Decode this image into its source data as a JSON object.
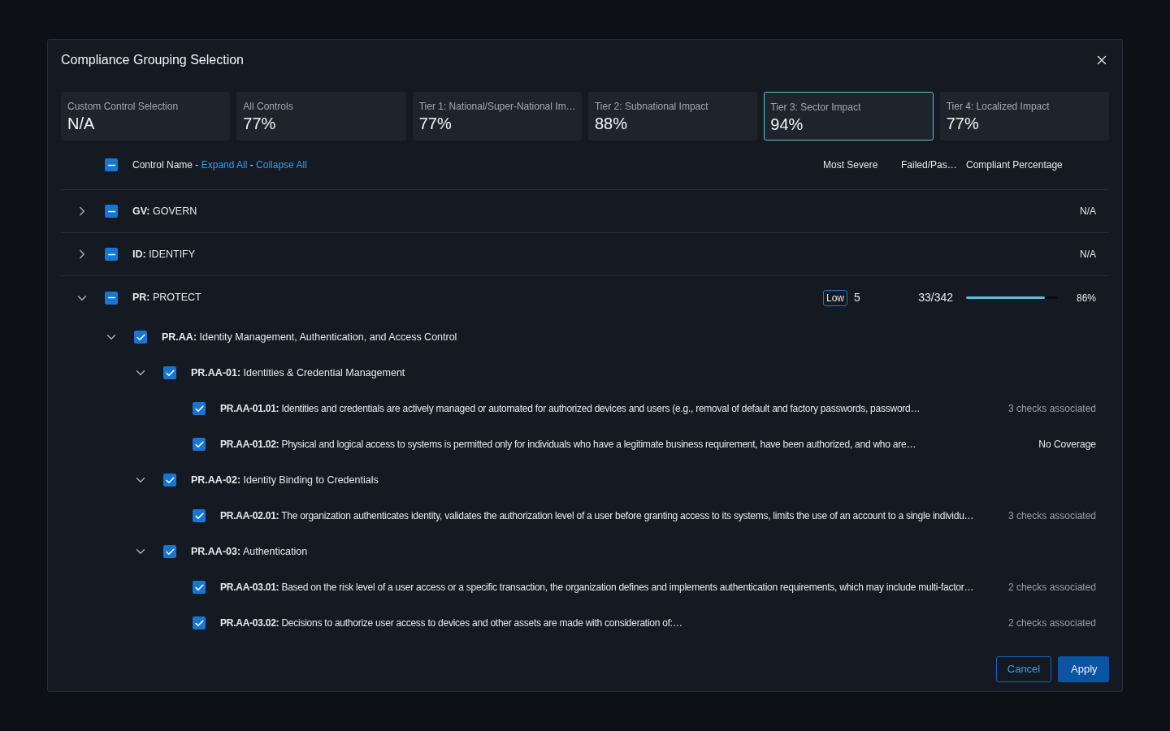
{
  "dialog": {
    "title": "Compliance Grouping Selection"
  },
  "cards": [
    {
      "label": "Custom Control Selection",
      "value": "N/A",
      "selected": false
    },
    {
      "label": "All Controls",
      "value": "77%",
      "selected": false
    },
    {
      "label": "Tier 1: National/Super-National Im…",
      "value": "77%",
      "selected": false
    },
    {
      "label": "Tier 2: Subnational Impact",
      "value": "88%",
      "selected": false
    },
    {
      "label": "Tier 3: Sector Impact",
      "value": "94%",
      "selected": true
    },
    {
      "label": "Tier 4: Localized Impact",
      "value": "77%",
      "selected": false
    }
  ],
  "header": {
    "checked": true,
    "partial": true,
    "parts": [
      {
        "kind": "text",
        "text": "Control Name - "
      },
      {
        "kind": "link",
        "text": "Expand All"
      },
      {
        "kind": "text",
        "text": " - "
      },
      {
        "kind": "link",
        "text": "Collapse All"
      }
    ],
    "columns": [
      "Most Severe",
      "Failed/Pas…",
      "Compliant Percentage"
    ]
  },
  "rows": [
    {
      "label": "**GV:** GOVERN",
      "checked": true,
      "partial": true,
      "expanded": false,
      "compliance": "N/A"
    },
    {
      "label": "**ID:** IDENTIFY",
      "checked": true,
      "partial": true,
      "expanded": false,
      "compliance": "N/A"
    },
    {
      "label": "**PR:** PROTECT",
      "checked": true,
      "partial": true,
      "expanded": true,
      "severity": "Low",
      "severe_count": "5",
      "failed_passed": "33/342",
      "level": 0.86,
      "compliance": "86%",
      "children": [
        {
          "label": "**PR.AA:** Identity Management, Authentication, and Access Control",
          "checked": true,
          "expanded": true,
          "children": [
            {
              "label": "**PR.AA-01:** Identities & Credential Management",
              "checked": true,
              "expanded": true,
              "children": [
                {
                  "label": "**PR.AA-01.01:** Identities and credentials are actively managed or automated for authorized devices and users (e.g., removal of default and factory passwords, password…",
                  "checked": true,
                  "coverage": "3 checks associated",
                  "covered": true
                },
                {
                  "label": "**PR.AA-01.02:** Physical and logical access to systems is permitted only for individuals who have a legitimate business requirement, have been authorized, and who are…",
                  "checked": true,
                  "coverage": "No Coverage",
                  "covered": false
                }
              ]
            },
            {
              "label": "**PR.AA-02:** Identity Binding to Credentials",
              "checked": true,
              "expanded": true,
              "children": [
                {
                  "label": "**PR.AA-02.01:** The organization authenticates identity, validates the authorization level of a user before granting access to its systems, limits the use of an account to a single individu…",
                  "checked": true,
                  "coverage": "3 checks associated",
                  "covered": true
                }
              ]
            },
            {
              "label": "**PR.AA-03:** Authentication",
              "checked": true,
              "expanded": true,
              "children": [
                {
                  "label": "**PR.AA-03.01:** Based on the risk level of a user access or a specific transaction, the organization defines and implements authentication requirements, which may include multi-factor…",
                  "checked": true,
                  "coverage": "2 checks associated",
                  "covered": true
                },
                {
                  "label": "**PR.AA-03.02:** Decisions to authorize user access to devices and other assets are made with consideration of:…",
                  "checked": true,
                  "coverage": "2 checks associated",
                  "covered": true
                }
              ]
            }
          ]
        }
      ]
    }
  ],
  "buttons": [
    {
      "label": "Cancel",
      "kind": "secondary"
    },
    {
      "label": "Apply",
      "kind": "primary"
    }
  ]
}
